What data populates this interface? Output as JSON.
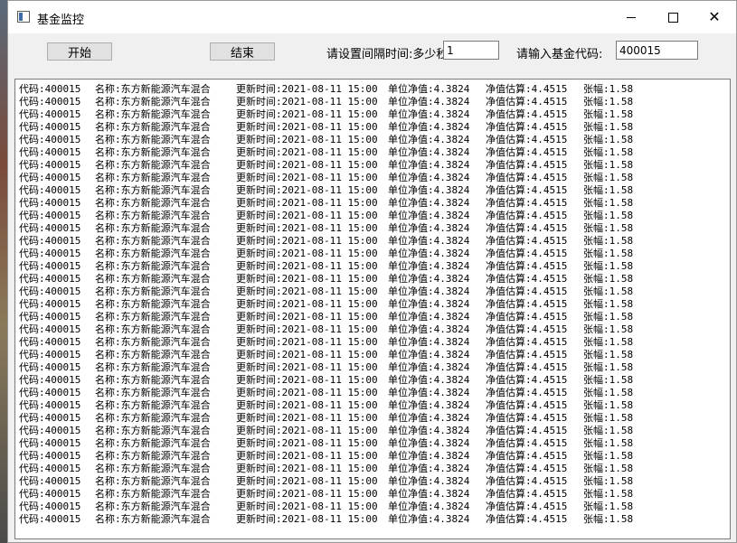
{
  "window": {
    "title": "基金监控",
    "icon": "app-window-icon"
  },
  "controls": {
    "start_label": "开始",
    "stop_label": "结束",
    "interval_label": "请设置间隔时间:多少秒",
    "interval_value": "1",
    "code_label": "请输入基金代码:",
    "code_value": "400015"
  },
  "output": {
    "row_count": 35,
    "row": {
      "code": "代码:400015",
      "name": "名称:东方新能源汽车混合",
      "update_time": "更新时间:2021-08-11 15:00",
      "nav": "单位净值:4.3824",
      "estimate": "净值估算:4.4515",
      "change": "张幅:1.58"
    }
  }
}
